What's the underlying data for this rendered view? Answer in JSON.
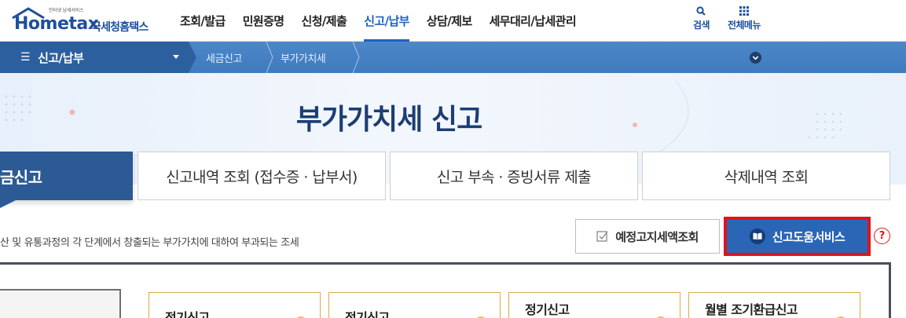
{
  "header": {
    "logo_tagline": "인터넷 납세서비스",
    "logo_brand": "Hometax",
    "logo_brand_kr": "국세청홈택스",
    "menu": [
      "조회/발급",
      "민원증명",
      "신청/제출",
      "신고/납부",
      "상담/제보",
      "세무대리/납세관리"
    ],
    "active_menu_index": 3,
    "search_label": "검색",
    "all_menu_label": "전체메뉴"
  },
  "subnav": {
    "current": "신고/납부",
    "breadcrumb": [
      "세금신고",
      "부가가치세"
    ]
  },
  "page": {
    "title": "부가가치세 신고",
    "tabs": [
      "금신고",
      "신고내역 조회 (접수증 · 납부서)",
      "신고 부속 · 증빙서류 제출",
      "삭제내역 조회"
    ],
    "active_tab_index": 0,
    "description": "산 및 유통과정의 각 단계에서 창출되는 부가가치에 대하여 부과되는 조세",
    "forecast_button": "예정고지세액조회",
    "help_button": "신고도움서비스",
    "help_icon_text": "?"
  },
  "cards": [
    "정기신고",
    "정기신고",
    "정기신고",
    "월별 조기환급신고"
  ],
  "colors": {
    "brand": "#1d4f9c",
    "active_menu": "#1d63c1",
    "subnav": "#3f7bbd",
    "active_tab": "#2b5a94",
    "help_button": "#2a66b5",
    "highlight": "#e1131a"
  }
}
